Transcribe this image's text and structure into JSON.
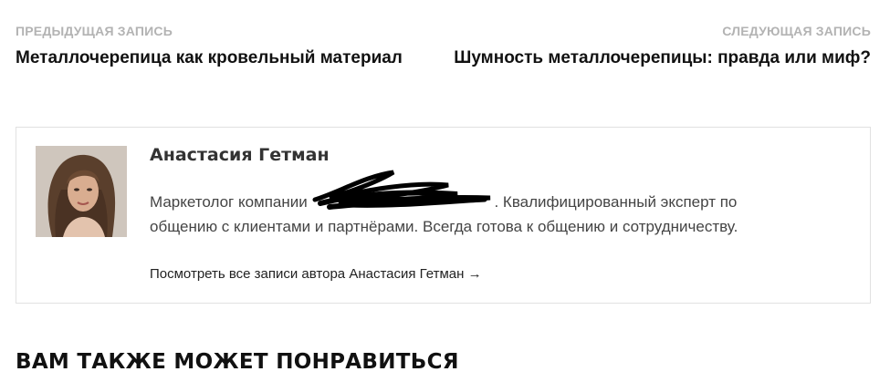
{
  "post_navigation": {
    "previous": {
      "label": "ПРЕДЫДУЩАЯ ЗАПИСЬ",
      "title": "Металлочерепица как кровельный материал"
    },
    "next": {
      "label": "СЛЕДУЮЩАЯ ЗАПИСЬ",
      "title": "Шумность металлочерепицы: правда или миф?"
    }
  },
  "author_box": {
    "name": "Анастасия Гетман",
    "bio_line1_before": "Маркетолог компании ",
    "bio_line1_after": ". Квалифицированный эксперт по",
    "bio_line2": "общению с клиентами и партнёрами. Всегда готова к общению и сотрудничеству.",
    "posts_link": "Посмотреть все записи автора Анастасия Гетман →"
  },
  "related": {
    "heading": "ВАМ ТАКЖЕ МОЖЕТ ПОНРАВИТЬСЯ"
  }
}
